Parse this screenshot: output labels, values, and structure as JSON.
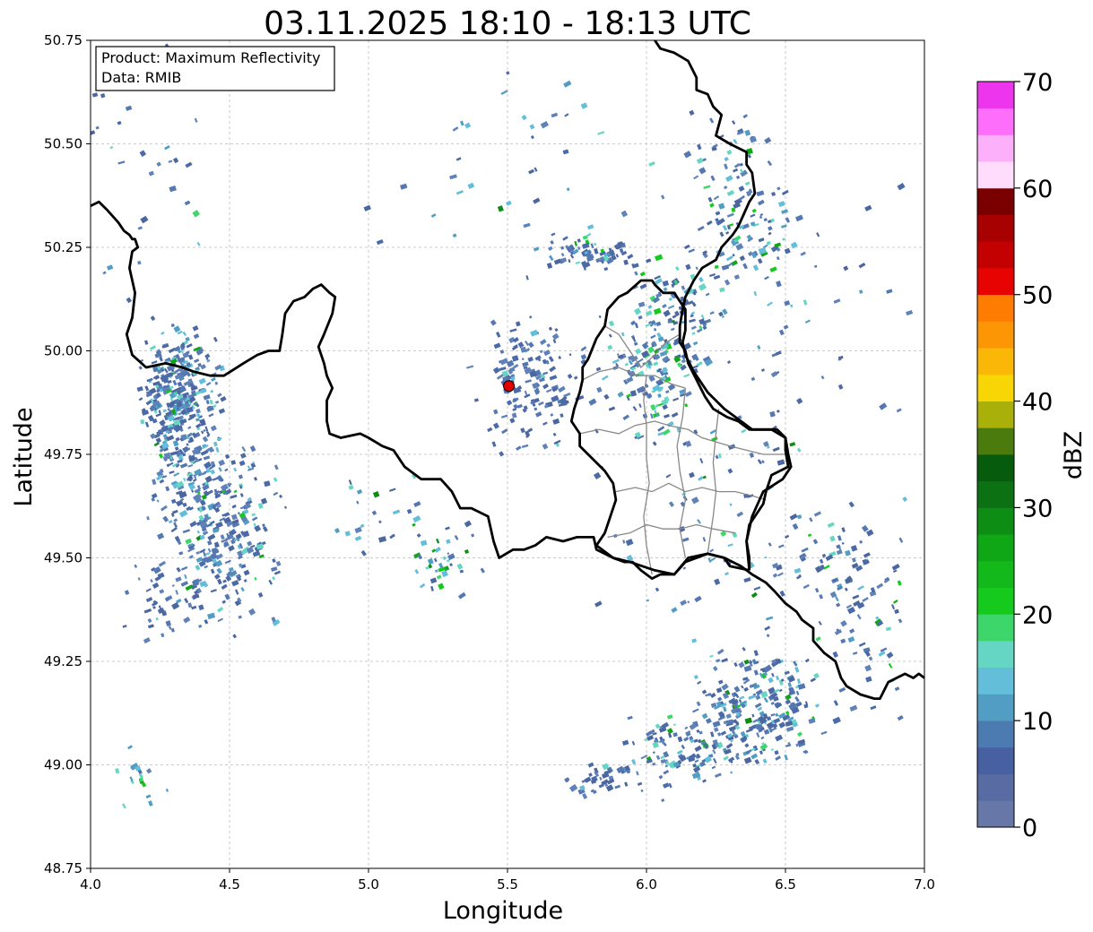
{
  "title": "03.11.2025 18:10 - 18:13 UTC",
  "info_box": {
    "product": "Product: Maximum Reflectivity",
    "data": "Data: RMIB"
  },
  "colorbar": {
    "label": "dBZ",
    "min": 0,
    "max": 70,
    "step": 2.5,
    "ticks": [
      "0",
      "10",
      "20",
      "30",
      "40",
      "50",
      "60",
      "70"
    ],
    "colors": [
      "#6777a8",
      "#586ba3",
      "#4760a1",
      "#4b7bb1",
      "#529dc3",
      "#62bed9",
      "#66d6c4",
      "#3dd66b",
      "#15c91d",
      "#13b91a",
      "#10a717",
      "#0e8d15",
      "#0b7112",
      "#065b0c",
      "#4a7b0c",
      "#a9b00a",
      "#f8d605",
      "#fbb707",
      "#fd9605",
      "#fe7c01",
      "#e80303",
      "#c40101",
      "#a70102",
      "#7a0000",
      "#ffdcfc",
      "#fdb0fa",
      "#fd6efa",
      "#ee35ee"
    ]
  },
  "chart_data": {
    "type": "map",
    "xlabel": "Longitude",
    "ylabel": "Latitude",
    "xlim": [
      4.0,
      7.0
    ],
    "ylim": [
      48.75,
      50.75
    ],
    "xticks": [
      "4.0",
      "4.5",
      "5.0",
      "5.5",
      "6.0",
      "6.5",
      "7.0"
    ],
    "yticks": [
      "48.75",
      "49.00",
      "49.25",
      "49.50",
      "49.75",
      "50.00",
      "50.25",
      "50.50",
      "50.75"
    ],
    "grid": true,
    "radar_site": {
      "lon": 5.505,
      "lat": 49.915,
      "color": "#e00000"
    },
    "country_border": [
      [
        [
          4.0,
          50.35
        ],
        [
          4.03,
          50.36
        ],
        [
          4.06,
          50.34
        ],
        [
          4.1,
          50.31
        ],
        [
          4.12,
          50.29
        ],
        [
          4.14,
          50.28
        ],
        [
          4.15,
          50.27
        ],
        [
          4.16,
          50.27
        ],
        [
          4.17,
          50.25
        ],
        [
          4.15,
          50.24
        ],
        [
          4.14,
          50.2
        ],
        [
          4.16,
          50.14
        ],
        [
          4.15,
          50.08
        ],
        [
          4.13,
          50.04
        ],
        [
          4.15,
          49.99
        ],
        [
          4.2,
          49.96
        ],
        [
          4.27,
          49.97
        ],
        [
          4.33,
          49.96
        ],
        [
          4.37,
          49.95
        ],
        [
          4.43,
          49.94
        ],
        [
          4.48,
          49.94
        ],
        [
          4.55,
          49.97
        ],
        [
          4.6,
          49.99
        ],
        [
          4.64,
          50.0
        ],
        [
          4.68,
          50.0
        ],
        [
          4.69,
          50.04
        ],
        [
          4.7,
          50.09
        ],
        [
          4.73,
          50.12
        ],
        [
          4.77,
          50.13
        ],
        [
          4.8,
          50.15
        ],
        [
          4.83,
          50.16
        ],
        [
          4.86,
          50.14
        ],
        [
          4.88,
          50.13
        ],
        [
          4.87,
          50.09
        ],
        [
          4.84,
          50.04
        ],
        [
          4.82,
          50.01
        ],
        [
          4.84,
          49.97
        ],
        [
          4.85,
          49.94
        ],
        [
          4.87,
          49.91
        ],
        [
          4.85,
          49.88
        ],
        [
          4.85,
          49.83
        ],
        [
          4.86,
          49.8
        ],
        [
          4.9,
          49.79
        ],
        [
          4.97,
          49.8
        ],
        [
          5.0,
          49.79
        ],
        [
          5.05,
          49.77
        ],
        [
          5.09,
          49.76
        ],
        [
          5.13,
          49.72
        ],
        [
          5.19,
          49.69
        ],
        [
          5.26,
          49.69
        ],
        [
          5.3,
          49.66
        ],
        [
          5.33,
          49.62
        ],
        [
          5.37,
          49.62
        ],
        [
          5.43,
          49.6
        ],
        [
          5.45,
          49.54
        ],
        [
          5.47,
          49.5
        ],
        [
          5.52,
          49.52
        ],
        [
          5.56,
          49.52
        ],
        [
          5.6,
          49.53
        ],
        [
          5.64,
          49.55
        ],
        [
          5.7,
          49.54
        ],
        [
          5.75,
          49.55
        ],
        [
          5.79,
          49.55
        ],
        [
          5.81,
          49.55
        ],
        [
          5.82,
          49.52
        ],
        [
          5.88,
          49.5
        ],
        [
          5.94,
          49.49
        ],
        [
          6.03,
          49.47
        ],
        [
          6.1,
          49.46
        ],
        [
          6.14,
          49.49
        ],
        [
          6.22,
          49.51
        ],
        [
          6.28,
          49.5
        ],
        [
          6.34,
          49.48
        ],
        [
          6.38,
          49.46
        ],
        [
          6.43,
          49.44
        ],
        [
          6.46,
          49.42
        ],
        [
          6.5,
          49.39
        ],
        [
          6.54,
          49.37
        ],
        [
          6.56,
          49.35
        ],
        [
          6.6,
          49.33
        ],
        [
          6.6,
          49.3
        ],
        [
          6.64,
          49.27
        ],
        [
          6.68,
          49.25
        ],
        [
          6.7,
          49.21
        ],
        [
          6.72,
          49.19
        ],
        [
          6.77,
          49.17
        ],
        [
          6.82,
          49.16
        ],
        [
          6.84,
          49.16
        ],
        [
          6.87,
          49.2
        ],
        [
          6.9,
          49.21
        ],
        [
          6.93,
          49.22
        ],
        [
          6.96,
          49.21
        ],
        [
          6.98,
          49.22
        ],
        [
          7.0,
          49.21
        ]
      ],
      [
        [
          6.03,
          50.75
        ],
        [
          6.05,
          50.73
        ],
        [
          6.1,
          50.72
        ],
        [
          6.15,
          50.7
        ],
        [
          6.18,
          50.66
        ],
        [
          6.18,
          50.63
        ],
        [
          6.22,
          50.62
        ],
        [
          6.24,
          50.59
        ],
        [
          6.27,
          50.57
        ],
        [
          6.25,
          50.52
        ],
        [
          6.3,
          50.5
        ],
        [
          6.33,
          50.49
        ],
        [
          6.36,
          50.48
        ],
        [
          6.36,
          50.45
        ],
        [
          6.38,
          50.43
        ],
        [
          6.39,
          50.38
        ],
        [
          6.37,
          50.36
        ],
        [
          6.35,
          50.33
        ],
        [
          6.33,
          50.3
        ],
        [
          6.31,
          50.28
        ],
        [
          6.27,
          50.25
        ],
        [
          6.25,
          50.22
        ],
        [
          6.2,
          50.2
        ],
        [
          6.17,
          50.17
        ],
        [
          6.14,
          50.13
        ],
        [
          6.13,
          50.1
        ],
        [
          6.12,
          50.06
        ],
        [
          6.12,
          50.02
        ],
        [
          6.14,
          50.0
        ],
        [
          6.15,
          49.97
        ],
        [
          6.18,
          49.93
        ],
        [
          6.21,
          49.89
        ],
        [
          6.24,
          49.86
        ],
        [
          6.29,
          49.84
        ],
        [
          6.33,
          49.83
        ],
        [
          6.37,
          49.81
        ],
        [
          6.42,
          49.81
        ],
        [
          6.47,
          49.81
        ],
        [
          6.5,
          49.79
        ],
        [
          6.5,
          49.76
        ],
        [
          6.51,
          49.72
        ],
        [
          6.45,
          49.7
        ],
        [
          6.43,
          49.66
        ],
        [
          6.42,
          49.63
        ],
        [
          6.37,
          49.58
        ],
        [
          6.36,
          49.54
        ],
        [
          6.37,
          49.5
        ],
        [
          6.37,
          49.47
        ]
      ],
      [
        [
          6.37,
          49.47
        ],
        [
          6.3,
          49.48
        ],
        [
          6.28,
          49.5
        ],
        [
          6.22,
          49.51
        ],
        [
          6.15,
          49.5
        ],
        [
          6.1,
          49.46
        ],
        [
          6.05,
          49.46
        ],
        [
          6.02,
          49.45
        ],
        [
          5.98,
          49.47
        ],
        [
          5.95,
          49.49
        ],
        [
          5.92,
          49.49
        ],
        [
          5.88,
          49.5
        ],
        [
          5.82,
          49.53
        ],
        [
          5.85,
          49.56
        ],
        [
          5.87,
          49.6
        ],
        [
          5.89,
          49.64
        ],
        [
          5.88,
          49.68
        ],
        [
          5.85,
          49.71
        ],
        [
          5.82,
          49.73
        ],
        [
          5.76,
          49.77
        ],
        [
          5.76,
          49.8
        ],
        [
          5.73,
          49.83
        ],
        [
          5.74,
          49.86
        ],
        [
          5.76,
          49.9
        ],
        [
          5.77,
          49.93
        ],
        [
          5.77,
          49.96
        ],
        [
          5.79,
          49.98
        ],
        [
          5.82,
          50.03
        ],
        [
          5.85,
          50.06
        ],
        [
          5.86,
          50.1
        ],
        [
          5.9,
          50.13
        ],
        [
          5.93,
          50.14
        ],
        [
          5.98,
          50.17
        ],
        [
          6.02,
          50.17
        ],
        [
          6.03,
          50.16
        ],
        [
          6.06,
          50.14
        ],
        [
          6.1,
          50.14
        ],
        [
          6.12,
          50.12
        ],
        [
          6.14,
          50.1
        ],
        [
          6.14,
          50.05
        ],
        [
          6.13,
          50.02
        ],
        [
          6.14,
          49.99
        ],
        [
          6.17,
          49.95
        ],
        [
          6.22,
          49.9
        ],
        [
          6.28,
          49.86
        ],
        [
          6.32,
          49.84
        ],
        [
          6.38,
          49.81
        ],
        [
          6.45,
          49.81
        ],
        [
          6.5,
          49.79
        ],
        [
          6.51,
          49.75
        ],
        [
          6.52,
          49.72
        ],
        [
          6.49,
          49.69
        ],
        [
          6.42,
          49.66
        ],
        [
          6.38,
          49.6
        ],
        [
          6.36,
          49.54
        ],
        [
          6.37,
          49.47
        ]
      ]
    ],
    "admin_borders": [
      [
        [
          5.77,
          49.93
        ],
        [
          5.83,
          49.95
        ],
        [
          5.9,
          49.96
        ],
        [
          5.97,
          49.94
        ],
        [
          6.03,
          49.94
        ],
        [
          6.09,
          49.92
        ],
        [
          6.14,
          49.91
        ]
      ],
      [
        [
          5.76,
          49.8
        ],
        [
          5.83,
          49.81
        ],
        [
          5.9,
          49.8
        ],
        [
          5.96,
          49.82
        ],
        [
          6.03,
          49.83
        ],
        [
          6.08,
          49.82
        ],
        [
          6.15,
          49.81
        ],
        [
          6.2,
          49.79
        ],
        [
          6.25,
          49.78
        ],
        [
          6.3,
          49.77
        ],
        [
          6.36,
          49.76
        ],
        [
          6.42,
          49.75
        ],
        [
          6.5,
          49.75
        ]
      ],
      [
        [
          5.89,
          49.66
        ],
        [
          5.96,
          49.67
        ],
        [
          6.02,
          49.66
        ],
        [
          6.08,
          49.68
        ],
        [
          6.14,
          49.66
        ],
        [
          6.2,
          49.67
        ],
        [
          6.26,
          49.66
        ],
        [
          6.32,
          49.66
        ],
        [
          6.38,
          49.65
        ],
        [
          6.43,
          49.64
        ]
      ],
      [
        [
          5.86,
          49.55
        ],
        [
          5.94,
          49.56
        ],
        [
          6.0,
          49.58
        ],
        [
          6.06,
          49.57
        ],
        [
          6.12,
          49.57
        ],
        [
          6.18,
          49.58
        ],
        [
          6.24,
          49.57
        ],
        [
          6.32,
          49.56
        ]
      ],
      [
        [
          6.0,
          49.94
        ],
        [
          5.99,
          49.88
        ],
        [
          6.0,
          49.82
        ],
        [
          6.0,
          49.74
        ],
        [
          6.01,
          49.68
        ],
        [
          5.99,
          49.6
        ],
        [
          6.0,
          49.53
        ],
        [
          6.02,
          49.46
        ]
      ],
      [
        [
          6.14,
          49.91
        ],
        [
          6.13,
          49.84
        ],
        [
          6.11,
          49.77
        ],
        [
          6.12,
          49.71
        ],
        [
          6.14,
          49.64
        ],
        [
          6.12,
          49.57
        ],
        [
          6.14,
          49.5
        ]
      ],
      [
        [
          6.26,
          49.86
        ],
        [
          6.25,
          49.8
        ],
        [
          6.24,
          49.73
        ],
        [
          6.25,
          49.66
        ],
        [
          6.24,
          49.6
        ],
        [
          6.22,
          49.51
        ]
      ],
      [
        [
          5.85,
          50.06
        ],
        [
          5.9,
          50.04
        ],
        [
          5.94,
          50.0
        ],
        [
          5.98,
          49.96
        ],
        [
          6.03,
          49.99
        ],
        [
          6.07,
          50.02
        ],
        [
          6.12,
          50.04
        ]
      ]
    ],
    "echo_clusters": [
      {
        "lon": 4.33,
        "lat": 49.82,
        "slon": 0.07,
        "slat": 0.1,
        "n": 300,
        "mix": [
          0.75,
          0.97
        ]
      },
      {
        "lon": 4.48,
        "lat": 49.56,
        "slon": 0.1,
        "slat": 0.09,
        "n": 260,
        "mix": [
          0.8,
          0.98
        ]
      },
      {
        "lon": 4.3,
        "lat": 49.93,
        "slon": 0.05,
        "slat": 0.06,
        "n": 110,
        "mix": [
          0.7,
          0.97
        ]
      },
      {
        "lon": 4.3,
        "lat": 49.38,
        "slon": 0.08,
        "slat": 0.05,
        "n": 50,
        "mix": [
          0.85,
          0.98
        ]
      },
      {
        "lon": 6.4,
        "lat": 49.14,
        "slon": 0.1,
        "slat": 0.07,
        "n": 230,
        "mix": [
          0.7,
          0.95
        ]
      },
      {
        "lon": 6.15,
        "lat": 49.04,
        "slon": 0.11,
        "slat": 0.04,
        "n": 110,
        "mix": [
          0.75,
          0.95
        ]
      },
      {
        "lon": 5.85,
        "lat": 48.96,
        "slon": 0.08,
        "slat": 0.02,
        "n": 40,
        "mix": [
          0.85,
          0.98
        ]
      },
      {
        "lon": 6.02,
        "lat": 49.93,
        "slon": 0.08,
        "slat": 0.06,
        "n": 110,
        "mix": [
          0.6,
          0.9
        ]
      },
      {
        "lon": 6.1,
        "lat": 50.07,
        "slon": 0.08,
        "slat": 0.07,
        "n": 110,
        "mix": [
          0.55,
          0.88
        ]
      },
      {
        "lon": 6.37,
        "lat": 50.28,
        "slon": 0.1,
        "slat": 0.06,
        "n": 80,
        "mix": [
          0.6,
          0.85
        ]
      },
      {
        "lon": 6.3,
        "lat": 50.45,
        "slon": 0.08,
        "slat": 0.06,
        "n": 50,
        "mix": [
          0.7,
          0.9
        ]
      },
      {
        "lon": 5.6,
        "lat": 49.93,
        "slon": 0.1,
        "slat": 0.07,
        "n": 150,
        "mix": [
          0.9,
          0.99
        ]
      },
      {
        "lon": 5.8,
        "lat": 50.23,
        "slon": 0.08,
        "slat": 0.02,
        "n": 70,
        "mix": [
          0.75,
          0.95
        ]
      },
      {
        "lon": 5.25,
        "lat": 49.48,
        "slon": 0.06,
        "slat": 0.04,
        "n": 30,
        "mix": [
          0.4,
          0.8
        ]
      },
      {
        "lon": 6.3,
        "lat": 49.6,
        "slon": 0.2,
        "slat": 0.15,
        "n": 90,
        "mix": [
          0.6,
          0.9
        ]
      },
      {
        "lon": 6.78,
        "lat": 49.35,
        "slon": 0.08,
        "slat": 0.12,
        "n": 70,
        "mix": [
          0.75,
          0.95
        ]
      },
      {
        "lon": 6.65,
        "lat": 49.5,
        "slon": 0.1,
        "slat": 0.06,
        "n": 40,
        "mix": [
          0.75,
          0.95
        ]
      },
      {
        "lon": 5.1,
        "lat": 49.58,
        "slon": 0.15,
        "slat": 0.06,
        "n": 30,
        "mix": [
          0.5,
          0.85
        ]
      },
      {
        "lon": 4.17,
        "lat": 48.96,
        "slon": 0.04,
        "slat": 0.03,
        "n": 18,
        "mix": [
          0.2,
          0.6
        ]
      },
      {
        "lon": 6.6,
        "lat": 50.1,
        "slon": 0.2,
        "slat": 0.15,
        "n": 40,
        "mix": [
          0.7,
          0.95
        ]
      },
      {
        "lon": 5.6,
        "lat": 50.4,
        "slon": 0.25,
        "slat": 0.15,
        "n": 40,
        "mix": [
          0.6,
          0.9
        ]
      },
      {
        "lon": 4.25,
        "lat": 50.45,
        "slon": 0.15,
        "slat": 0.15,
        "n": 30,
        "mix": [
          0.8,
          0.97
        ]
      }
    ]
  }
}
